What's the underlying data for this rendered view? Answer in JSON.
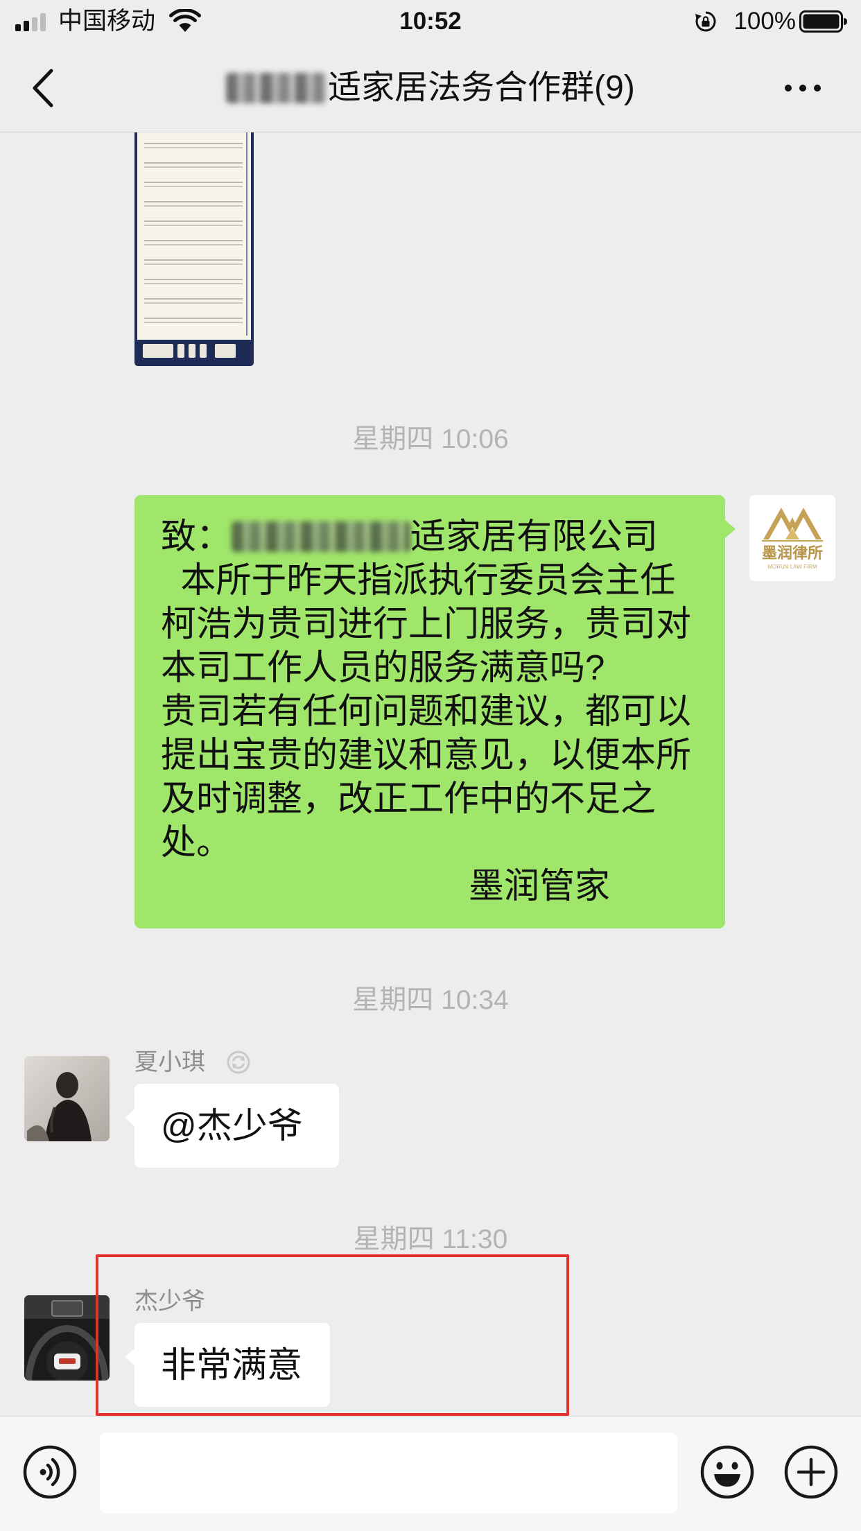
{
  "status_bar": {
    "carrier": "中国移动",
    "time": "10:52",
    "battery_percent": "100%",
    "battery_level": 1.0
  },
  "nav": {
    "title": "适家居法务合作群(9)"
  },
  "chat": {
    "timestamp_1": "星期四 10:06",
    "timestamp_2": "星期四 10:34",
    "timestamp_3": "星期四 11:30",
    "outgoing_message": {
      "sender_logo": {
        "name": "墨润律所",
        "subtitle": "MORUN LAW FIRM"
      },
      "greeting_prefix": "致：",
      "greeting_suffix": "适家居有限公司",
      "lines": [
        "  本所于昨天指派执行委员会主任",
        "柯浩为贵司进行上门服务，贵司对",
        "本司工作人员的服务满意吗?",
        "贵司若有任何问题和建议，都可以",
        "提出宝贵的建议和意见，以便本所",
        "及时调整，改正工作中的不足之",
        "处。"
      ],
      "signature": "墨润管家"
    },
    "incoming_messages": [
      {
        "sender": "夏小琪",
        "text": "@杰少爷"
      },
      {
        "sender": "杰少爷",
        "text": "非常满意"
      }
    ]
  },
  "icons": {
    "status": [
      "signal-icon",
      "wifi-icon",
      "orientation-lock-icon",
      "battery-icon"
    ],
    "nav": [
      "back-chevron-icon",
      "more-icon"
    ],
    "input_bar": [
      "voice-icon",
      "emoji-icon",
      "plus-icon"
    ]
  },
  "colors": {
    "background": "#ededed",
    "outgoing_bubble": "#a0e66b",
    "incoming_bubble": "#ffffff",
    "timestamp_text": "#b3b3b3",
    "highlight_box": "#e3312d"
  }
}
